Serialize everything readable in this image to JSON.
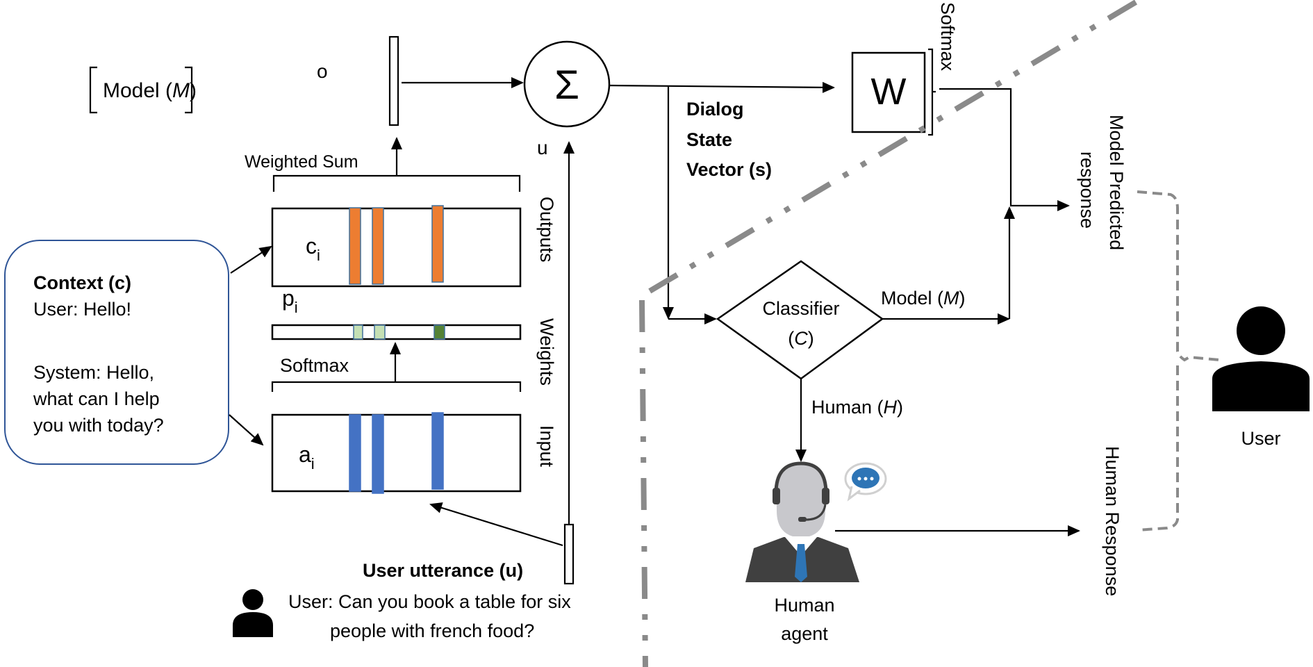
{
  "model_label": {
    "prefix": "Model (",
    "var": "M",
    "suffix": ")"
  },
  "memory": {
    "o_label": "o",
    "u_label": "u",
    "weighted_sum_label": "Weighted Sum",
    "softmax_label": "Softmax",
    "outputs_label": "Outputs",
    "weights_label": "Weights",
    "input_label": "Input",
    "c_label": "c",
    "p_label": "p",
    "a_label": "a",
    "subscript": "i",
    "sigma_symbol": "Σ"
  },
  "context": {
    "title": "Context (c)",
    "lines": [
      "User: Hello!",
      "",
      "System: Hello,",
      "what can I help",
      "you with today?"
    ]
  },
  "utterance": {
    "title": "User utterance (u)",
    "line1": "User: Can you book a table for six",
    "line2": "people with french food?"
  },
  "dialog_state": {
    "line1": "Dialog",
    "line2": "State",
    "line3": "Vector (s)"
  },
  "w_box": {
    "label": "W",
    "softmax_label": "Softmax"
  },
  "classifier": {
    "line1": "Classifier",
    "line2_prefix": "(",
    "line2_var": "C",
    "line2_suffix": ")"
  },
  "branches": {
    "model": {
      "prefix": "Model (",
      "var": "M",
      "suffix": ")"
    },
    "human": {
      "prefix": "Human (",
      "var": "H",
      "suffix": ")"
    }
  },
  "human_agent": {
    "line1": "Human",
    "line2": "agent"
  },
  "responses": {
    "model_line1": "Model Predicted",
    "model_line2": "response",
    "human": "Human Response"
  },
  "user_label": "User",
  "colors": {
    "output_bar": "#ed7d31",
    "input_bar": "#4472c4",
    "weight_light": "#c5e0b4",
    "weight_dark": "#548235",
    "context_border": "#2f5597",
    "divider": "#8a8a8a",
    "agent_suit": "#404040",
    "agent_tie": "#2e75b6",
    "agent_skin": "#c8c8cc"
  }
}
